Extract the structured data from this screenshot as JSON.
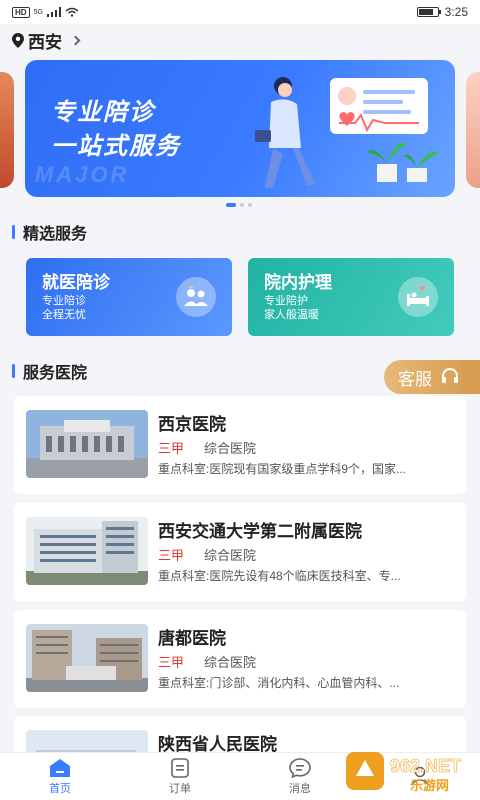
{
  "status_bar": {
    "network_badge": "HD",
    "signal_label": "5G",
    "time": "3:25",
    "battery_level": 0.8
  },
  "location": {
    "city": "西安"
  },
  "banner": {
    "line1": "专业陪诊",
    "line2": "一站式服务",
    "bg_text": "MAJOR",
    "dots": 3,
    "active_dot": 0
  },
  "featured": {
    "title": "精选服务",
    "cards": [
      {
        "title": "就医陪诊",
        "sub1": "专业陪诊",
        "sub2": "全程无忧",
        "icon": "people-icon"
      },
      {
        "title": "院内护理",
        "sub1": "专业陪护",
        "sub2": "家人般温暖",
        "icon": "bed-care-icon"
      }
    ]
  },
  "customer_service": {
    "label": "客服",
    "icon": "headset-icon"
  },
  "hospitals": {
    "title": "服务医院",
    "items": [
      {
        "name": "西京医院",
        "level": "三甲",
        "type": "综合医院",
        "desc": "重点科室:医院现有国家级重点学科9个，国家..."
      },
      {
        "name": "西安交通大学第二附属医院",
        "level": "三甲",
        "type": "综合医院",
        "desc": "重点科室:医院先设有48个临床医技科室、专..."
      },
      {
        "name": "唐都医院",
        "level": "三甲",
        "type": "综合医院",
        "desc": "重点科室:门诊部、消化内科、心血管内科、..."
      },
      {
        "name": "陕西省人民医院",
        "level": "",
        "type": "",
        "desc": ""
      }
    ]
  },
  "bottom_nav": [
    {
      "label": "首页",
      "icon": "home-icon",
      "active": true
    },
    {
      "label": "订单",
      "icon": "order-icon",
      "active": false
    },
    {
      "label": "消息",
      "icon": "message-icon",
      "active": false
    },
    {
      "label": "",
      "icon": "profile-icon",
      "active": false
    }
  ],
  "watermark": {
    "brand": "962.NET",
    "sub": "乐游网"
  },
  "colors": {
    "accent": "#3b7bff",
    "level_red": "#e0372f",
    "teal": "#21b3a3",
    "gold": "#d59b4f"
  }
}
